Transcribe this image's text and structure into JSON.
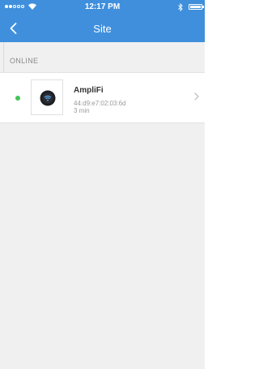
{
  "status_bar": {
    "signal_icon": "signal-dots-icon",
    "wifi_icon": "wifi-icon",
    "time": "12:17 PM",
    "bluetooth_icon": "bluetooth-icon",
    "battery_icon": "battery-icon"
  },
  "nav": {
    "back_icon": "chevron-left-icon",
    "title": "Site"
  },
  "section": {
    "header": "ONLINE"
  },
  "devices": [
    {
      "status": "online",
      "status_color": "#46c35a",
      "thumbnail_icon": "amplifi-router-icon",
      "name": "AmpliFi",
      "mac": "44:d9:e7:02:03:6d",
      "uptime": "3 min",
      "chevron_icon": "chevron-right-icon"
    }
  ],
  "colors": {
    "header_background": "#3f8fdd",
    "page_background": "#f0f0f0",
    "online_dot": "#46c35a"
  }
}
